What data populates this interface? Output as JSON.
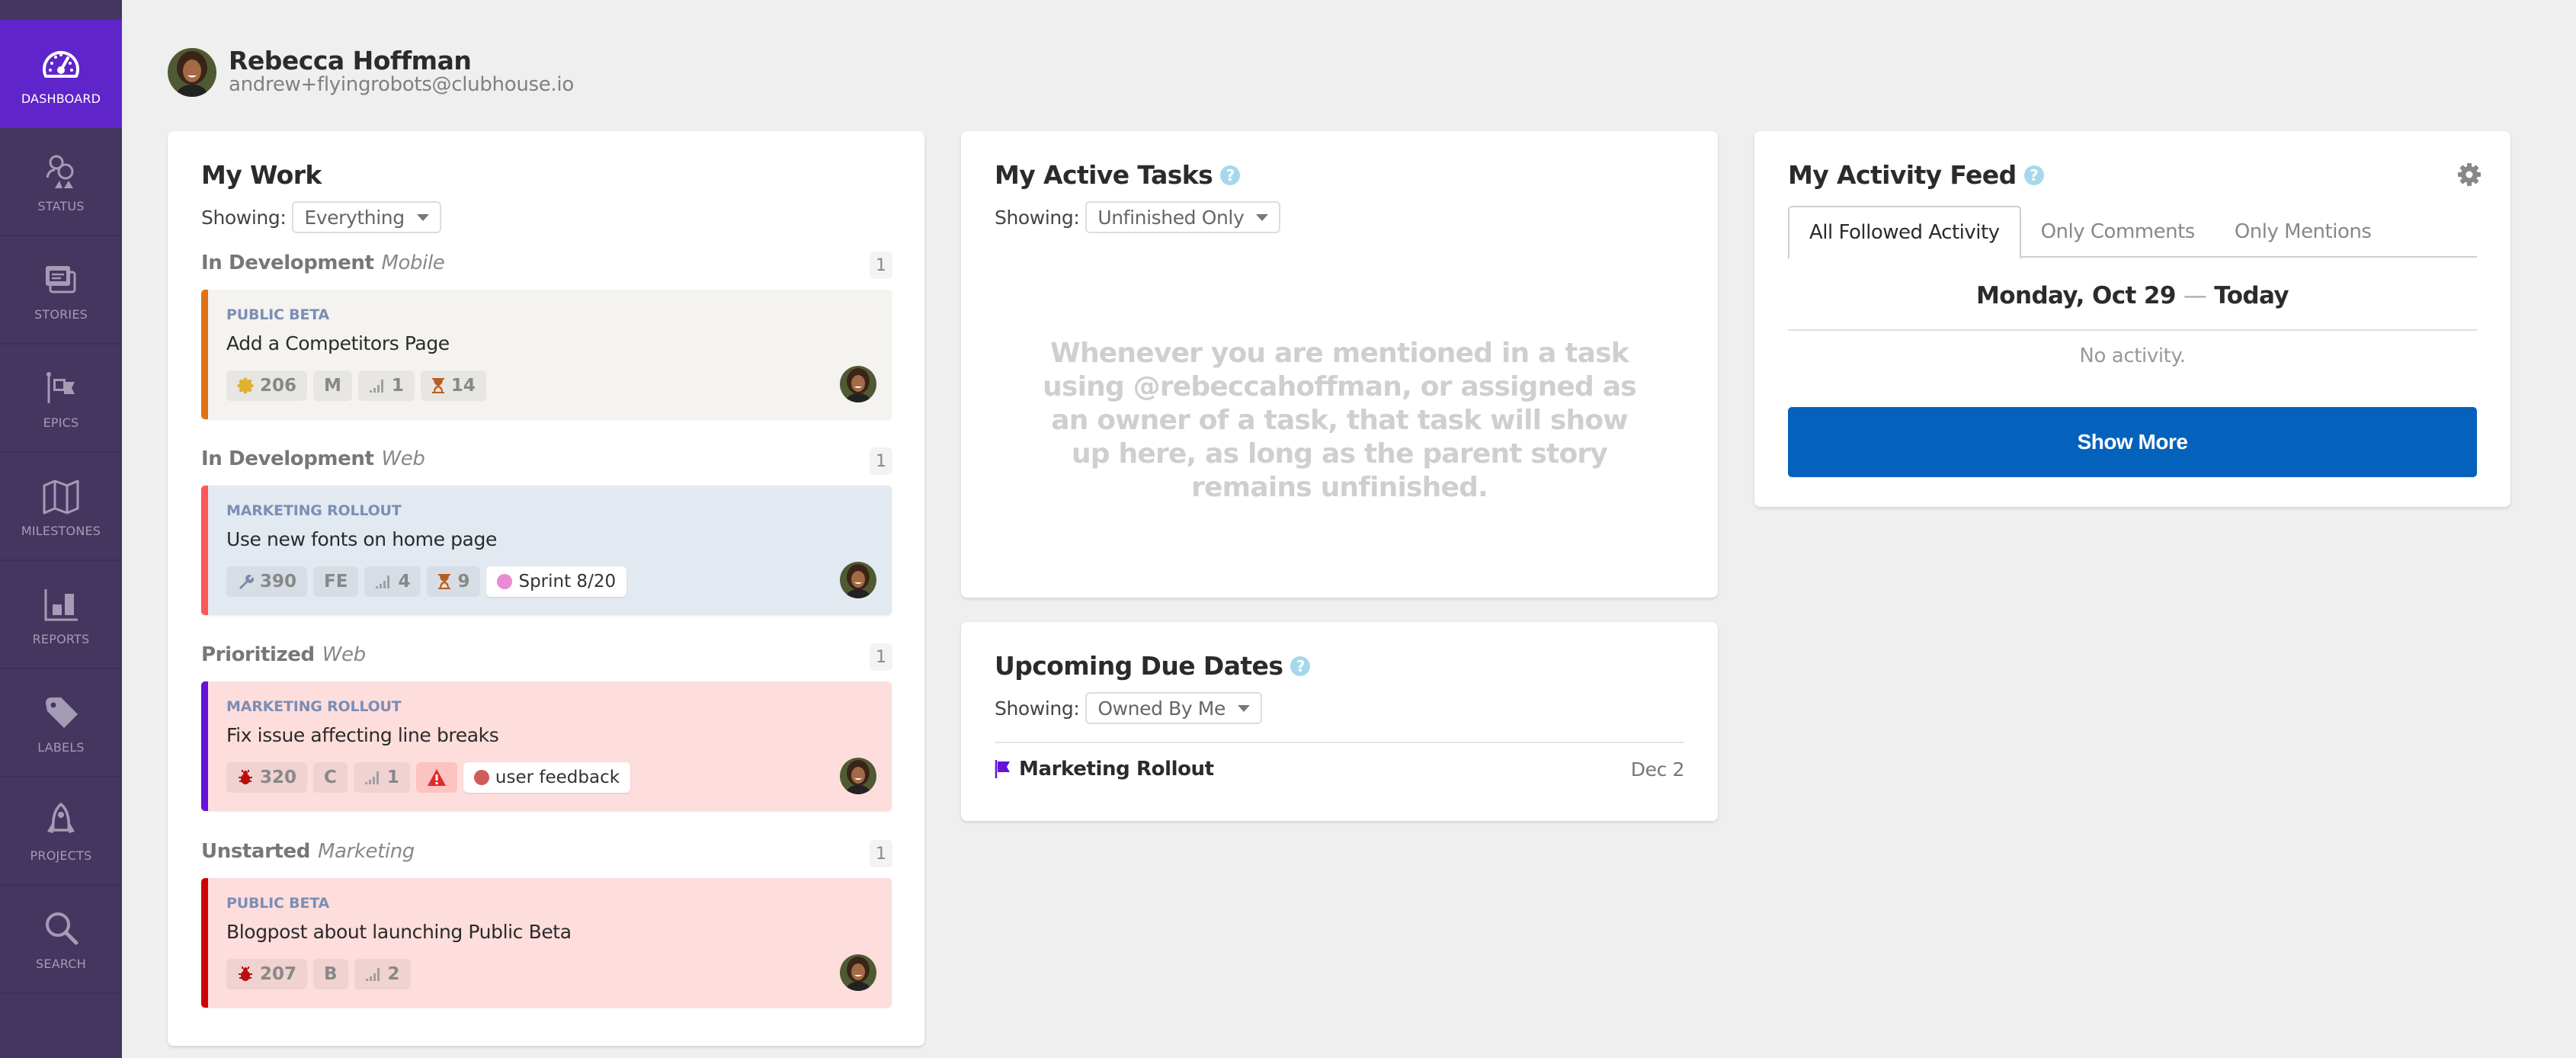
{
  "sidebar": {
    "items": [
      {
        "label": "DASHBOARD",
        "icon": "dashboard-gauge-icon",
        "active": true
      },
      {
        "label": "STATUS",
        "icon": "status-people-icon"
      },
      {
        "label": "STORIES",
        "icon": "stories-cards-icon"
      },
      {
        "label": "EPICS",
        "icon": "epics-flag-icon"
      },
      {
        "label": "MILESTONES",
        "icon": "milestones-map-icon"
      },
      {
        "label": "REPORTS",
        "icon": "reports-bar-chart-icon"
      },
      {
        "label": "LABELS",
        "icon": "labels-tag-icon"
      },
      {
        "label": "PROJECTS",
        "icon": "projects-rocket-icon"
      },
      {
        "label": "SEARCH",
        "icon": "search-magnifier-icon"
      }
    ]
  },
  "user": {
    "name": "Rebecca Hoffman",
    "email": "andrew+flyingrobots@clubhouse.io"
  },
  "my_work": {
    "title": "My Work",
    "showing_label": "Showing:",
    "filter": "Everything",
    "groups": [
      {
        "state": "In Development",
        "project": "Mobile",
        "count": "1",
        "story": {
          "epic": "PUBLIC BETA",
          "title": "Add a Competitors Page",
          "type": "feature",
          "id": "206",
          "project_chip": "M",
          "estimate": "1",
          "age": "14",
          "label": null,
          "accent": "#e07215",
          "bg": "#f4f3f0"
        }
      },
      {
        "state": "In Development",
        "project": "Web",
        "count": "1",
        "story": {
          "epic": "MARKETING ROLLOUT",
          "title": "Use new fonts on home page",
          "type": "chore",
          "id": "390",
          "project_chip": "FE",
          "estimate": "4",
          "age": "9",
          "label": "Sprint 8/20",
          "label_color": "#e98ad4",
          "accent": "#fd5757",
          "bg": "#e3e9f1"
        }
      },
      {
        "state": "Prioritized",
        "project": "Web",
        "count": "1",
        "story": {
          "epic": "MARKETING ROLLOUT",
          "title": "Fix issue affecting line breaks",
          "type": "bug",
          "id": "320",
          "project_chip": "C",
          "estimate": "1",
          "blocked": true,
          "label": "user feedback",
          "label_color": "#cf5c5c",
          "accent": "#6513d9",
          "bg": "#fddedd"
        }
      },
      {
        "state": "Unstarted",
        "project": "Marketing",
        "count": "1",
        "story": {
          "epic": "PUBLIC BETA",
          "title": "Blogpost about launching Public Beta",
          "type": "bug",
          "id": "207",
          "project_chip": "B",
          "estimate": "2",
          "label": null,
          "accent": "#cf0000",
          "bg": "#fddedd"
        }
      }
    ]
  },
  "active_tasks": {
    "title": "My Active Tasks",
    "showing_label": "Showing:",
    "filter": "Unfinished Only",
    "empty_message": "Whenever you are mentioned in a task using @rebeccahoffman, or assigned as an owner of a task, that task will show up here, as long as the parent story remains unfinished."
  },
  "due_dates": {
    "title": "Upcoming Due Dates",
    "showing_label": "Showing:",
    "filter": "Owned By Me",
    "items": [
      {
        "name": "Marketing Rollout",
        "date": "Dec 2",
        "icon": "epic-flag-icon"
      }
    ]
  },
  "activity_feed": {
    "title": "My Activity Feed",
    "tabs": [
      {
        "label": "All Followed Activity",
        "active": true
      },
      {
        "label": "Only Comments"
      },
      {
        "label": "Only Mentions"
      }
    ],
    "date_label": "Monday, Oct 29",
    "date_separator": "—",
    "date_relative": "Today",
    "empty_message": "No activity.",
    "show_more_label": "Show More"
  },
  "colors": {
    "sidebar_bg": "#453660",
    "sidebar_active": "#5f25cb",
    "primary_button": "#0562bc",
    "help_icon": "#a5d8ec"
  }
}
